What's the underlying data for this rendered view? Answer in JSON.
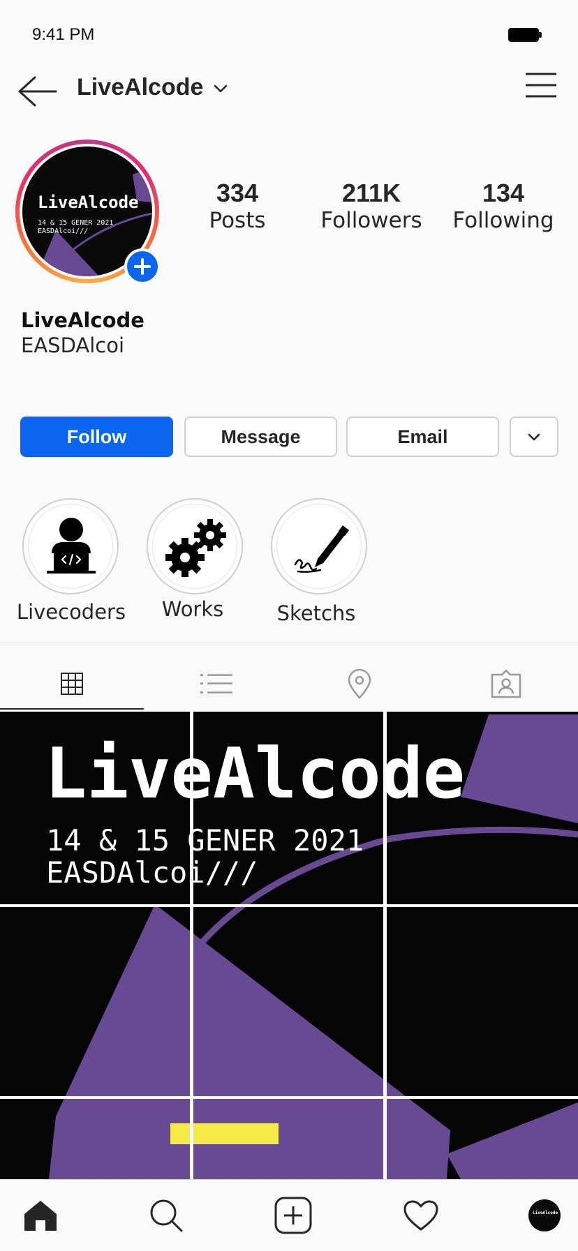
{
  "status_bar": {
    "time": "9:41 PM"
  },
  "header": {
    "username": "LiveAlcode"
  },
  "profile": {
    "avatar": {
      "title": "LiveAlcode",
      "subtitle_line1": "14 & 15 GENER 2021",
      "subtitle_line2": "EASDAlcoi///"
    },
    "stats": [
      {
        "value": "334",
        "label": "Posts"
      },
      {
        "value": "211K",
        "label": "Followers"
      },
      {
        "value": "134",
        "label": "Following"
      }
    ],
    "name": "LiveAlcode",
    "bio": "EASDAlcoi"
  },
  "actions": {
    "follow": "Follow",
    "message": "Message",
    "email": "Email"
  },
  "highlights": [
    {
      "label": "Livecoders",
      "icon": "coder-laptop-icon"
    },
    {
      "label": "Works",
      "icon": "gears-icon"
    },
    {
      "label": "Sketchs",
      "icon": "pen-sketch-icon"
    }
  ],
  "tabs": [
    "grid-icon",
    "list-icon",
    "location-pin-icon",
    "tagged-person-icon"
  ],
  "grid_poster": {
    "title": "LiveAlcode",
    "subtitle_line1": "14 & 15 GENER 2021",
    "subtitle_line2": "EASDAlcoi///",
    "colors": {
      "background": "#050505",
      "purple": "#674a93",
      "yellow": "#f5e945"
    }
  },
  "bottom_nav": [
    "home-icon",
    "search-icon",
    "new-post-icon",
    "activity-heart-icon",
    "profile-avatar"
  ],
  "colors": {
    "accent": "#0a66f0",
    "text": "#262626",
    "background": "#fafafa"
  }
}
